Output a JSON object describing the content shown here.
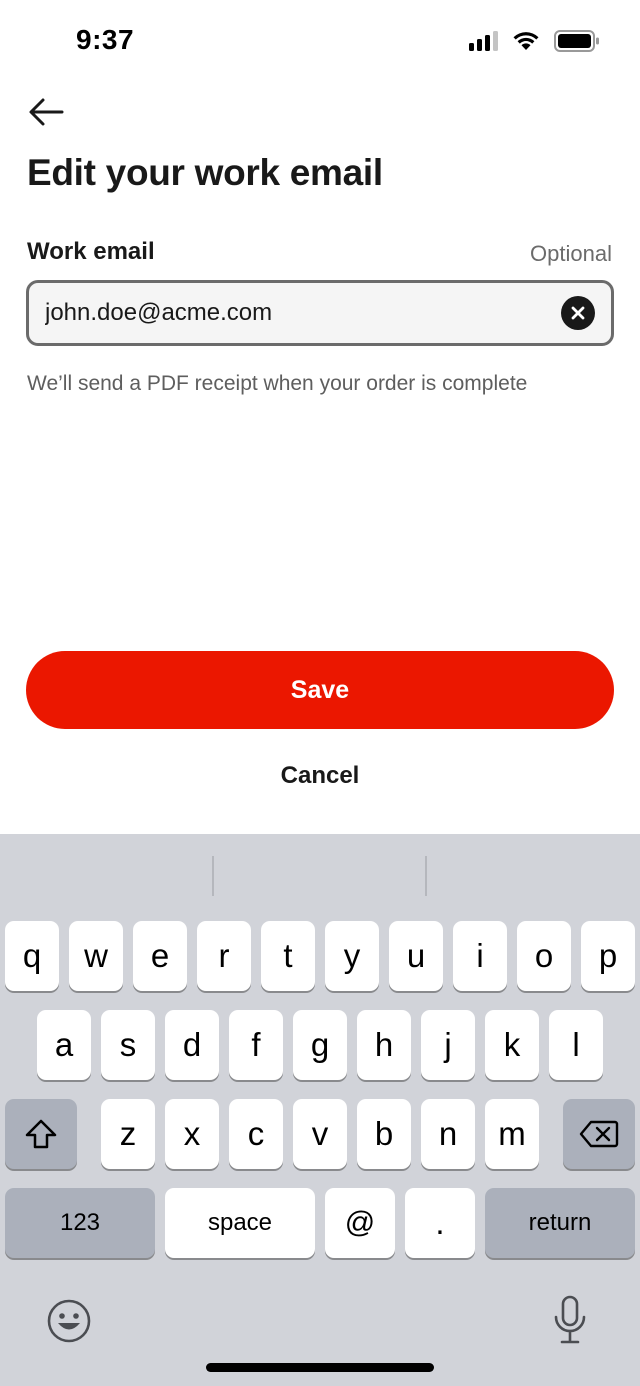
{
  "status_bar": {
    "time": "9:37"
  },
  "header": {
    "title": "Edit your work email"
  },
  "field": {
    "label": "Work email",
    "optional": "Optional",
    "value": "john.doe@acme.com",
    "helper": "We’ll send a PDF receipt when your order is complete"
  },
  "actions": {
    "save_label": "Save",
    "cancel_label": "Cancel"
  },
  "keyboard": {
    "row1": [
      "q",
      "w",
      "e",
      "r",
      "t",
      "y",
      "u",
      "i",
      "o",
      "p"
    ],
    "row2": [
      "a",
      "s",
      "d",
      "f",
      "g",
      "h",
      "j",
      "k",
      "l"
    ],
    "row3": [
      "z",
      "x",
      "c",
      "v",
      "b",
      "n",
      "m"
    ],
    "numbers_label": "123",
    "space_label": "space",
    "at_label": "@",
    "dot_label": ".",
    "return_label": "return"
  },
  "colors": {
    "accent": "#eb1700",
    "keyboard_bg": "#d1d3d9"
  }
}
